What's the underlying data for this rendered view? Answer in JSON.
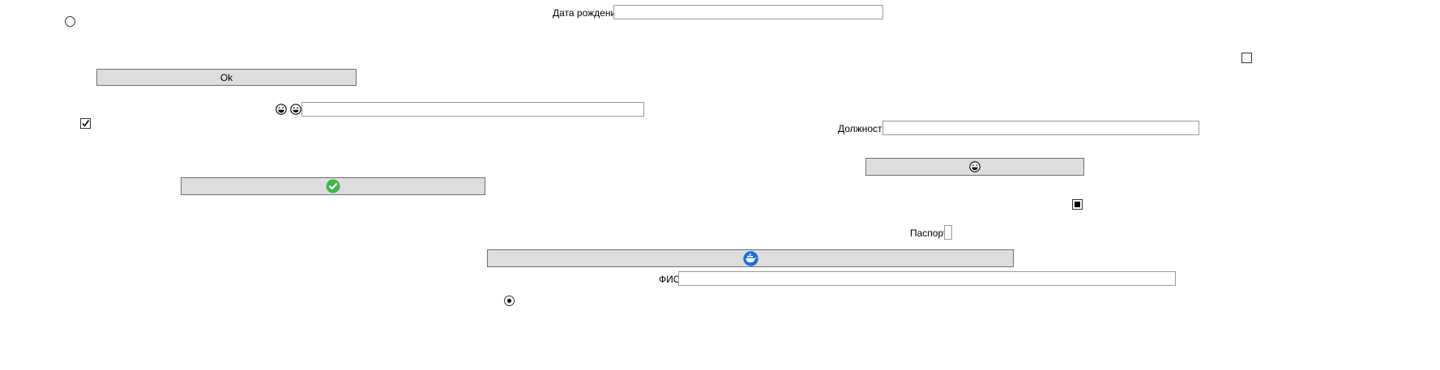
{
  "labels": {
    "birth_date": "Дата рождения",
    "position": "Должность",
    "passport": "Паспорт",
    "fio": "ФИО"
  },
  "fields": {
    "birth_date_value": "",
    "emoji_field_value": "",
    "position_value": "",
    "passport_value": "",
    "fio_value": ""
  },
  "buttons": {
    "ok_label": "Ok"
  },
  "controls": {
    "radio_top_checked": false,
    "radio_bottom_checked": true,
    "checkbox_top_right_checked": false,
    "checkbox_left_checked": true,
    "checkbox_indeterminate": true
  },
  "icons": {
    "emoji_1": "grinning-face-icon",
    "emoji_2": "smiling-face-icon",
    "button_emoji": "laughing-face-icon",
    "success": "green-check-circle-icon",
    "docker": "docker-whale-icon"
  },
  "colors": {
    "button_bg": "#dddddd",
    "button_border": "#707070",
    "field_border": "#9a9a9a",
    "success_green": "#43b548",
    "docker_blue": "#1d6fd6"
  }
}
